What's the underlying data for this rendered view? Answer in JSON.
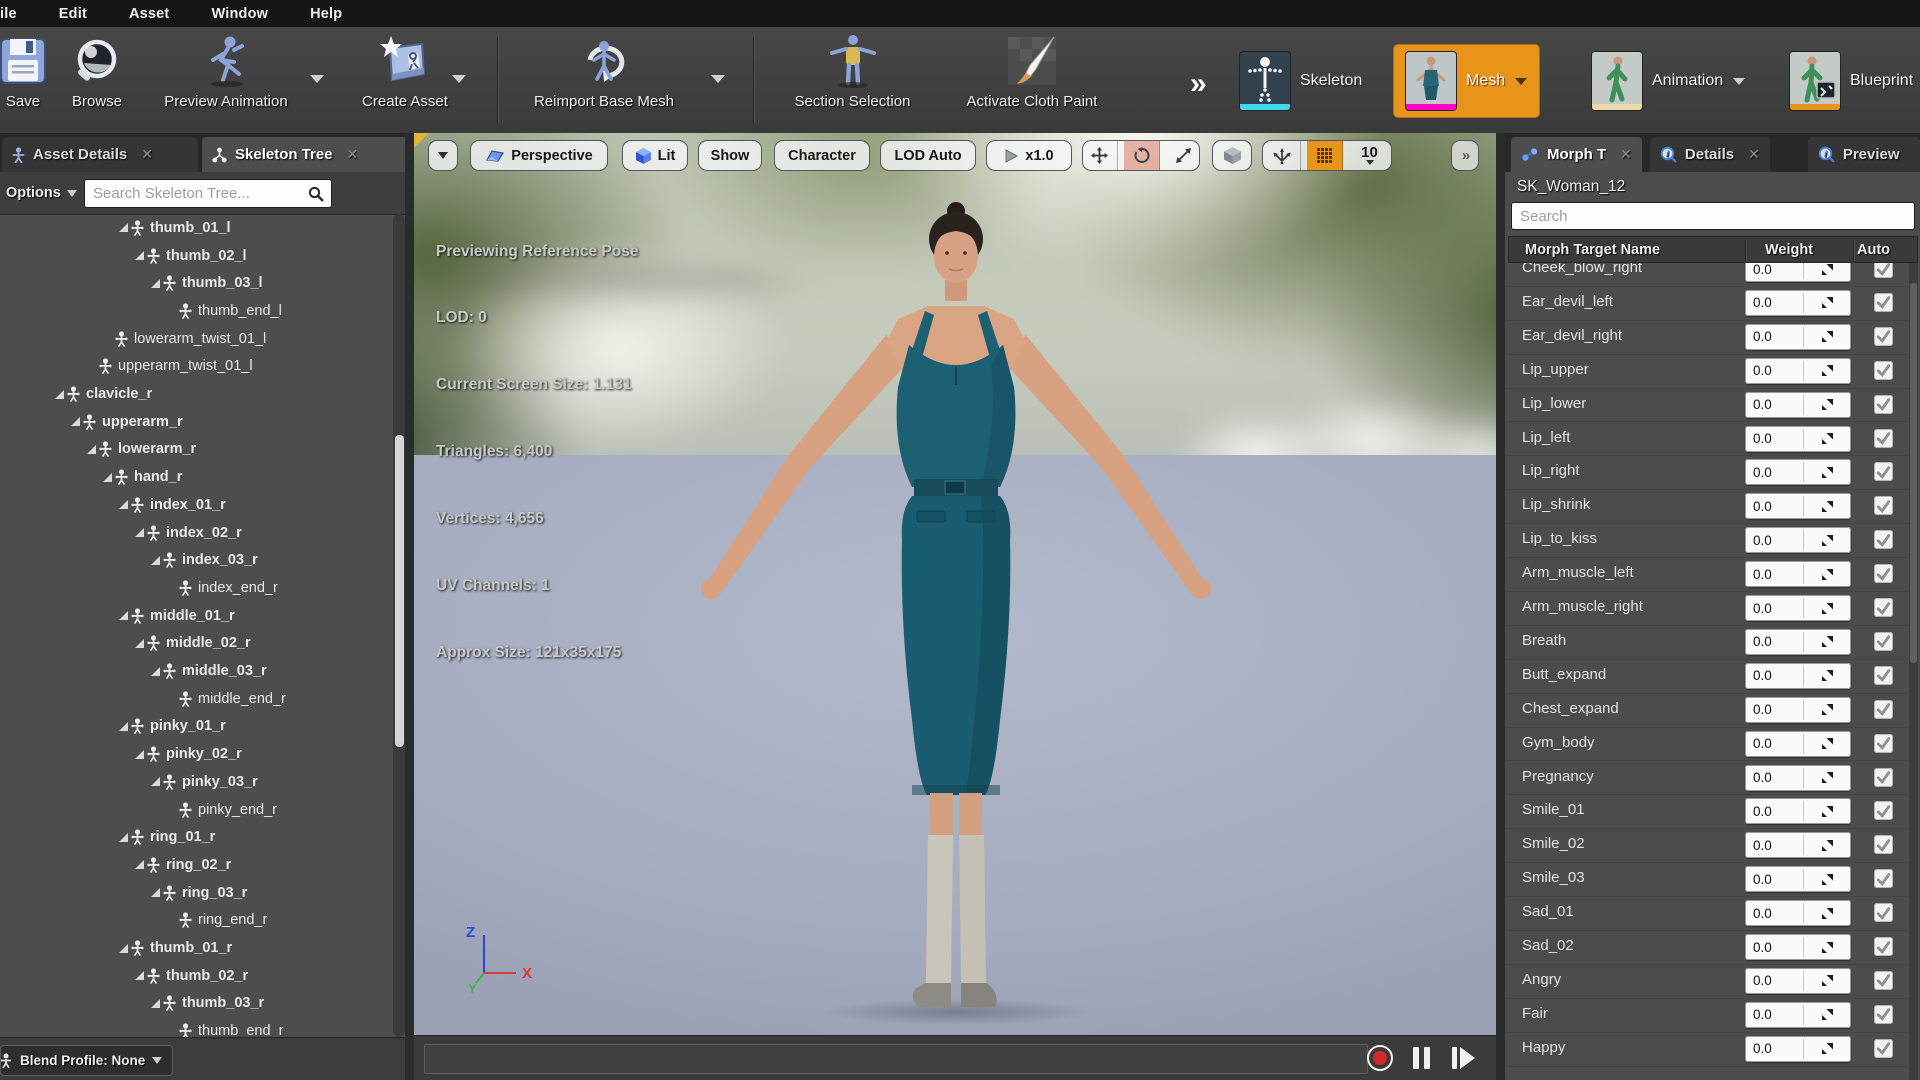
{
  "menu_bar": {
    "items": [
      "File",
      "Edit",
      "Asset",
      "Window",
      "Help"
    ]
  },
  "toolbar": {
    "buttons": [
      {
        "label": "Save",
        "icon": "save-icon"
      },
      {
        "label": "Browse",
        "icon": "browse-icon"
      },
      {
        "label": "Preview Animation",
        "icon": "preview-animation-icon",
        "dropdown": true
      },
      {
        "label": "Create Asset",
        "icon": "create-asset-icon",
        "dropdown": true
      },
      {
        "label": "Reimport Base Mesh",
        "icon": "reimport-base-mesh-icon",
        "dropdown": true
      },
      {
        "label": "Section Selection",
        "icon": "section-selection-icon"
      },
      {
        "label": "Activate Cloth Paint",
        "icon": "cloth-paint-icon"
      }
    ],
    "overflow_chevron": "»",
    "modes": [
      {
        "label": "Skeleton",
        "active": false,
        "strip_color": "#3fd8ec"
      },
      {
        "label": "Mesh",
        "active": true,
        "strip_color": "#ff00cc",
        "dropdown": true
      },
      {
        "label": "Animation",
        "active": false,
        "strip_color": "#ecd9a8",
        "dropdown": true
      },
      {
        "label": "Blueprint",
        "active": false,
        "strip_color": "#e8941a"
      }
    ]
  },
  "left_panel": {
    "tabs": [
      {
        "label": "Asset Details",
        "active": false
      },
      {
        "label": "Skeleton Tree",
        "active": true
      }
    ],
    "options_label": "Options",
    "search_placeholder": "Search Skeleton Tree...",
    "blend_profile_label": "Blend Profile: None",
    "tree": [
      {
        "name": "thumb_01_l",
        "level": 4,
        "bold": true,
        "caret": true
      },
      {
        "name": "thumb_02_l",
        "level": 5,
        "bold": true,
        "caret": true
      },
      {
        "name": "thumb_03_l",
        "level": 6,
        "bold": true,
        "caret": true
      },
      {
        "name": "thumb_end_l",
        "level": 7,
        "bold": false,
        "caret": false
      },
      {
        "name": "lowerarm_twist_01_l",
        "level": 3,
        "bold": false,
        "caret": false
      },
      {
        "name": "upperarm_twist_01_l",
        "level": 2,
        "bold": false,
        "caret": false
      },
      {
        "name": "clavicle_r",
        "level": 0,
        "bold": true,
        "caret": true
      },
      {
        "name": "upperarm_r",
        "level": 1,
        "bold": true,
        "caret": true
      },
      {
        "name": "lowerarm_r",
        "level": 2,
        "bold": true,
        "caret": true
      },
      {
        "name": "hand_r",
        "level": 3,
        "bold": true,
        "caret": true
      },
      {
        "name": "index_01_r",
        "level": 4,
        "bold": true,
        "caret": true
      },
      {
        "name": "index_02_r",
        "level": 5,
        "bold": true,
        "caret": true
      },
      {
        "name": "index_03_r",
        "level": 6,
        "bold": true,
        "caret": true
      },
      {
        "name": "index_end_r",
        "level": 7,
        "bold": false,
        "caret": false
      },
      {
        "name": "middle_01_r",
        "level": 4,
        "bold": true,
        "caret": true
      },
      {
        "name": "middle_02_r",
        "level": 5,
        "bold": true,
        "caret": true
      },
      {
        "name": "middle_03_r",
        "level": 6,
        "bold": true,
        "caret": true
      },
      {
        "name": "middle_end_r",
        "level": 7,
        "bold": false,
        "caret": false
      },
      {
        "name": "pinky_01_r",
        "level": 4,
        "bold": true,
        "caret": true
      },
      {
        "name": "pinky_02_r",
        "level": 5,
        "bold": true,
        "caret": true
      },
      {
        "name": "pinky_03_r",
        "level": 6,
        "bold": true,
        "caret": true
      },
      {
        "name": "pinky_end_r",
        "level": 7,
        "bold": false,
        "caret": false
      },
      {
        "name": "ring_01_r",
        "level": 4,
        "bold": true,
        "caret": true
      },
      {
        "name": "ring_02_r",
        "level": 5,
        "bold": true,
        "caret": true
      },
      {
        "name": "ring_03_r",
        "level": 6,
        "bold": true,
        "caret": true
      },
      {
        "name": "ring_end_r",
        "level": 7,
        "bold": false,
        "caret": false
      },
      {
        "name": "thumb_01_r",
        "level": 4,
        "bold": true,
        "caret": true
      },
      {
        "name": "thumb_02_r",
        "level": 5,
        "bold": true,
        "caret": true
      },
      {
        "name": "thumb_03_r",
        "level": 6,
        "bold": true,
        "caret": true
      },
      {
        "name": "thumb_end_r",
        "level": 7,
        "bold": false,
        "caret": false
      }
    ]
  },
  "viewport": {
    "toolbar": {
      "perspective": "Perspective",
      "lit": "Lit",
      "show": "Show",
      "character": "Character",
      "lod": "LOD Auto",
      "speed": "x1.0",
      "grid_size": "10"
    },
    "stats": [
      "Previewing Reference Pose",
      "LOD: 0",
      "Current Screen Size: 1.131",
      "Triangles: 6,400",
      "Vertices: 4,656",
      "UV Channels: 1",
      "Approx Size: 121x35x175"
    ],
    "axis": {
      "x": "X",
      "y": "Y",
      "z": "Z"
    }
  },
  "right_panel": {
    "tabs": [
      {
        "label": "Morph T",
        "active": true
      },
      {
        "label": "Details",
        "active": false
      },
      {
        "label": "Preview",
        "active": false
      }
    ],
    "asset_name": "SK_Woman_12",
    "search_placeholder": "Search",
    "columns": [
      "Morph Target Name",
      "Weight",
      "Auto"
    ],
    "morph_targets": [
      {
        "name": "Cheek_blow_right",
        "weight": "0.0",
        "auto": true
      },
      {
        "name": "Ear_devil_left",
        "weight": "0.0",
        "auto": true
      },
      {
        "name": "Ear_devil_right",
        "weight": "0.0",
        "auto": true
      },
      {
        "name": "Lip_upper",
        "weight": "0.0",
        "auto": true
      },
      {
        "name": "Lip_lower",
        "weight": "0.0",
        "auto": true
      },
      {
        "name": "Lip_left",
        "weight": "0.0",
        "auto": true
      },
      {
        "name": "Lip_right",
        "weight": "0.0",
        "auto": true
      },
      {
        "name": "Lip_shrink",
        "weight": "0.0",
        "auto": true
      },
      {
        "name": "Lip_to_kiss",
        "weight": "0.0",
        "auto": true
      },
      {
        "name": "Arm_muscle_left",
        "weight": "0.0",
        "auto": true
      },
      {
        "name": "Arm_muscle_right",
        "weight": "0.0",
        "auto": true
      },
      {
        "name": "Breath",
        "weight": "0.0",
        "auto": true
      },
      {
        "name": "Butt_expand",
        "weight": "0.0",
        "auto": true
      },
      {
        "name": "Chest_expand",
        "weight": "0.0",
        "auto": true
      },
      {
        "name": "Gym_body",
        "weight": "0.0",
        "auto": true
      },
      {
        "name": "Pregnancy",
        "weight": "0.0",
        "auto": true
      },
      {
        "name": "Smile_01",
        "weight": "0.0",
        "auto": true
      },
      {
        "name": "Smile_02",
        "weight": "0.0",
        "auto": true
      },
      {
        "name": "Smile_03",
        "weight": "0.0",
        "auto": true
      },
      {
        "name": "Sad_01",
        "weight": "0.0",
        "auto": true
      },
      {
        "name": "Sad_02",
        "weight": "0.0",
        "auto": true
      },
      {
        "name": "Angry",
        "weight": "0.0",
        "auto": true
      },
      {
        "name": "Fair",
        "weight": "0.0",
        "auto": true
      },
      {
        "name": "Happy",
        "weight": "0.0",
        "auto": true
      }
    ]
  },
  "colors": {
    "accent_orange": "#e8941a",
    "skeleton_strip": "#3fd8ec",
    "mesh_strip": "#ff00cc",
    "animation_strip": "#ecd9a8",
    "blueprint_strip": "#e8941a",
    "record_red": "#cf2b2b",
    "viewport_floor": "#a9b0c3",
    "axis_x": "#d83b30",
    "axis_y": "#3bb54a",
    "axis_z": "#2b47d8"
  }
}
